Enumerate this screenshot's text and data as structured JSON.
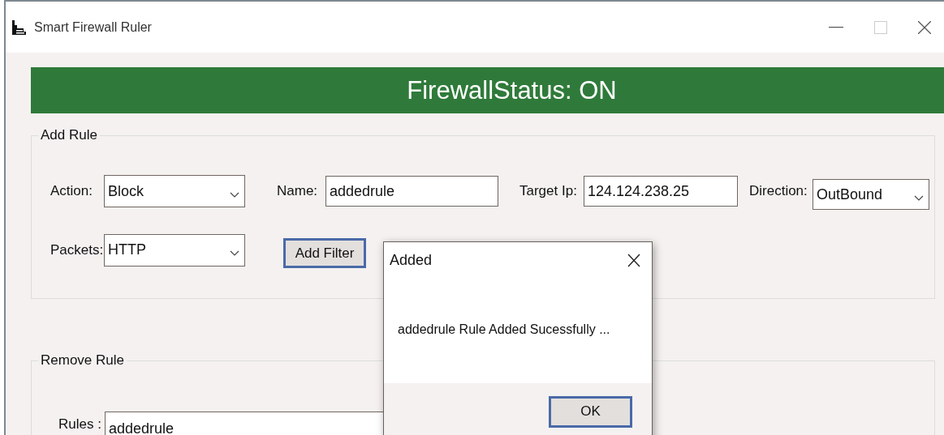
{
  "window": {
    "title": "Smart Firewall Ruler"
  },
  "status_banner": {
    "text": "FirewallStatus: ON"
  },
  "add_rule": {
    "title": "Add Rule",
    "action": {
      "label": "Action:",
      "value": "Block"
    },
    "name": {
      "label": "Name:",
      "value": "addedrule"
    },
    "target_ip": {
      "label": "Target Ip:",
      "value": "124.124.238.25"
    },
    "direction": {
      "label": "Direction:",
      "value": "OutBound"
    },
    "packets": {
      "label": "Packets:",
      "value": "HTTP"
    },
    "button": "Add Filter"
  },
  "remove_rule": {
    "title": "Remove Rule",
    "rules": {
      "label": "Rules :",
      "value": "addedrule"
    }
  },
  "dialog": {
    "title": "Added",
    "message": "addedrule Rule Added Sucessfully ...",
    "button": "OK"
  }
}
